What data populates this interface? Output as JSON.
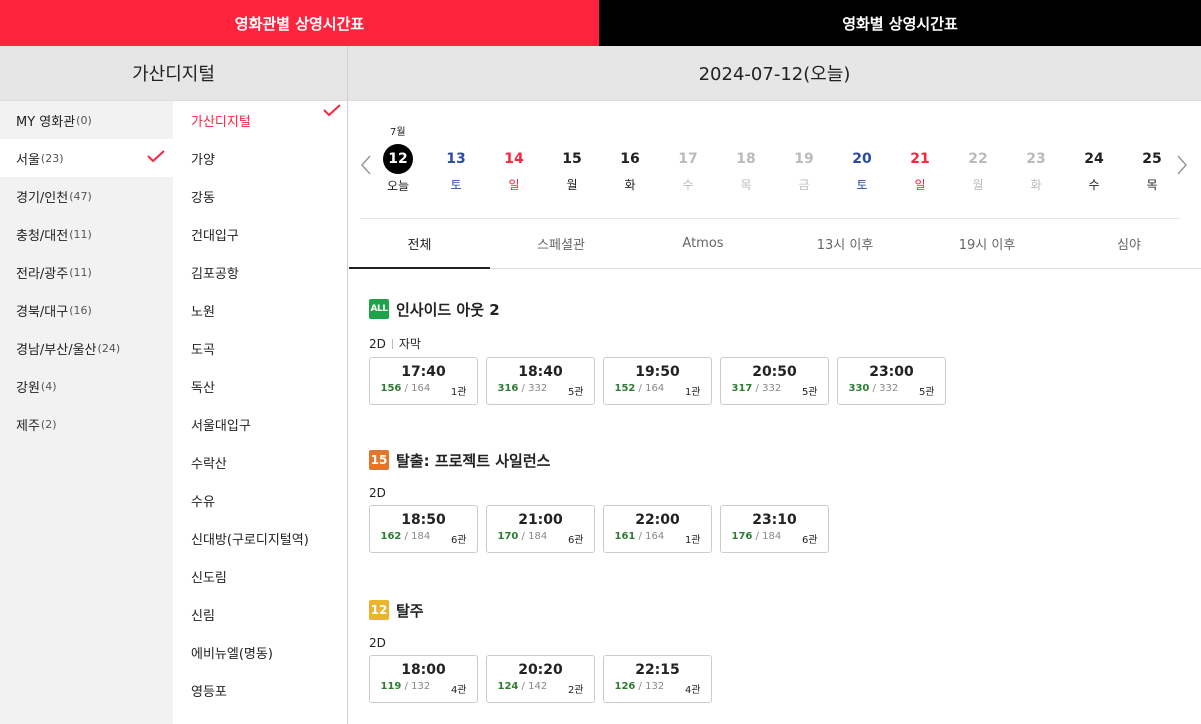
{
  "top_tabs": [
    "영화관별 상영시간표",
    "영화별 상영시간표"
  ],
  "left_header": "가산디지털",
  "right_header": "2024-07-12(오늘)",
  "regions": [
    {
      "name": "MY 영화관",
      "count": "(0)"
    },
    {
      "name": "서울",
      "count": "(23)"
    },
    {
      "name": "경기/인천",
      "count": "(47)"
    },
    {
      "name": "충청/대전",
      "count": "(11)"
    },
    {
      "name": "전라/광주",
      "count": "(11)"
    },
    {
      "name": "경북/대구",
      "count": "(16)"
    },
    {
      "name": "경남/부산/울산",
      "count": "(24)"
    },
    {
      "name": "강원",
      "count": "(4)"
    },
    {
      "name": "제주",
      "count": "(2)"
    }
  ],
  "selected_region_index": 1,
  "theaters": [
    "가산디지털",
    "가양",
    "강동",
    "건대입구",
    "김포공항",
    "노원",
    "도곡",
    "독산",
    "서울대입구",
    "수락산",
    "수유",
    "신대방(구로디지털역)",
    "신도림",
    "신림",
    "에비뉴엘(명동)",
    "영등포"
  ],
  "selected_theater_index": 0,
  "month_label": "7월",
  "days": [
    {
      "num": "12",
      "dow": "오늘",
      "kind": "today"
    },
    {
      "num": "13",
      "dow": "토",
      "kind": "sat"
    },
    {
      "num": "14",
      "dow": "일",
      "kind": "sun"
    },
    {
      "num": "15",
      "dow": "월",
      "kind": "normal"
    },
    {
      "num": "16",
      "dow": "화",
      "kind": "normal"
    },
    {
      "num": "17",
      "dow": "수",
      "kind": "dis"
    },
    {
      "num": "18",
      "dow": "목",
      "kind": "dis"
    },
    {
      "num": "19",
      "dow": "금",
      "kind": "dis"
    },
    {
      "num": "20",
      "dow": "토",
      "kind": "sat"
    },
    {
      "num": "21",
      "dow": "일",
      "kind": "sun"
    },
    {
      "num": "22",
      "dow": "월",
      "kind": "dis"
    },
    {
      "num": "23",
      "dow": "화",
      "kind": "dis"
    },
    {
      "num": "24",
      "dow": "수",
      "kind": "normal"
    },
    {
      "num": "25",
      "dow": "목",
      "kind": "normal"
    }
  ],
  "filter_tabs": [
    "전체",
    "스페셜관",
    "Atmos",
    "13시 이후",
    "19시 이후",
    "심야"
  ],
  "active_filter_index": 0,
  "movies": [
    {
      "rating": "ALL",
      "rating_kind": "all",
      "title": "인사이드 아웃 2",
      "format": "2D",
      "subtitle": "자막",
      "showtimes": [
        {
          "time": "17:40",
          "avail": "156",
          "total": " / 164",
          "hall": "1관"
        },
        {
          "time": "18:40",
          "avail": "316",
          "total": " / 332",
          "hall": "5관"
        },
        {
          "time": "19:50",
          "avail": "152",
          "total": " / 164",
          "hall": "1관"
        },
        {
          "time": "20:50",
          "avail": "317",
          "total": " / 332",
          "hall": "5관"
        },
        {
          "time": "23:00",
          "avail": "330",
          "total": " / 332",
          "hall": "5관"
        }
      ]
    },
    {
      "rating": "15",
      "rating_kind": "b15",
      "title": "탈출: 프로젝트 사일런스",
      "format": "2D",
      "subtitle": "",
      "showtimes": [
        {
          "time": "18:50",
          "avail": "162",
          "total": " / 184",
          "hall": "6관"
        },
        {
          "time": "21:00",
          "avail": "170",
          "total": " / 184",
          "hall": "6관"
        },
        {
          "time": "22:00",
          "avail": "161",
          "total": " / 164",
          "hall": "1관"
        },
        {
          "time": "23:10",
          "avail": "176",
          "total": " / 184",
          "hall": "6관"
        }
      ]
    },
    {
      "rating": "12",
      "rating_kind": "b12",
      "title": "탈주",
      "format": "2D",
      "subtitle": "",
      "showtimes": [
        {
          "time": "18:00",
          "avail": "119",
          "total": " / 132",
          "hall": "4관"
        },
        {
          "time": "20:20",
          "avail": "124",
          "total": " / 142",
          "hall": "2관"
        },
        {
          "time": "22:15",
          "avail": "126",
          "total": " / 132",
          "hall": "4관"
        }
      ]
    }
  ],
  "colors": {
    "accent": "#ff243e",
    "saturday": "#2a4aa6",
    "available": "#2e7d32"
  }
}
